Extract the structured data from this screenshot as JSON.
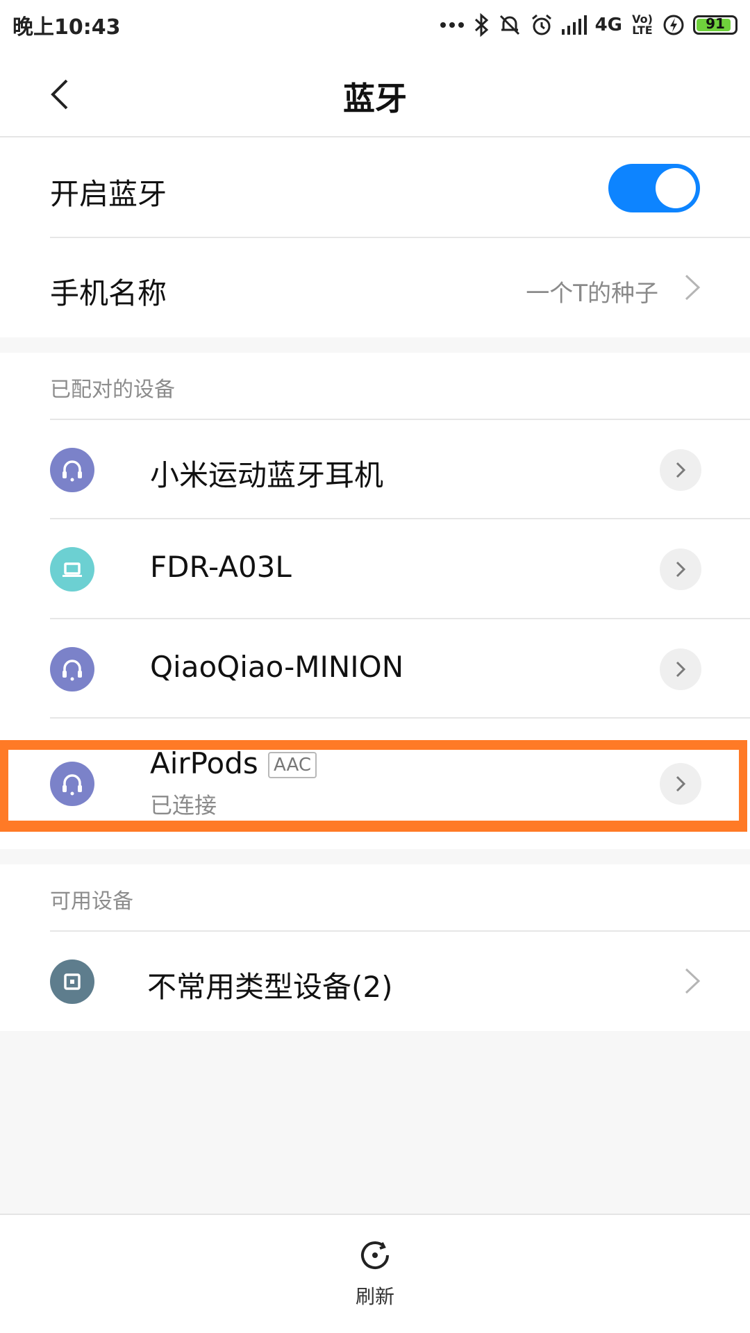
{
  "status_bar": {
    "time": "晚上10:43",
    "network": "4G",
    "volte": "Vo) LTE",
    "battery": "91",
    "battery_level": 0.91
  },
  "header": {
    "title": "蓝牙",
    "back_icon": "chevron-left-icon"
  },
  "settings": {
    "bluetooth_toggle_label": "开启蓝牙",
    "bluetooth_on": true,
    "phone_name_label": "手机名称",
    "phone_name_value": "一个T的种子"
  },
  "paired": {
    "header": "已配对的设备",
    "devices": [
      {
        "name": "小米运动蓝牙耳机",
        "icon": "headset-icon",
        "color": "#7b82c9"
      },
      {
        "name": "FDR-A03L",
        "icon": "laptop-icon",
        "color": "#6cd0d2"
      },
      {
        "name": "QiaoQiao-MINION",
        "icon": "headset-icon",
        "color": "#7b82c9"
      },
      {
        "name": "AirPods",
        "badge": "AAC",
        "status": "已连接",
        "icon": "headset-icon",
        "color": "#7b82c9"
      }
    ]
  },
  "available": {
    "header": "可用设备",
    "items": [
      {
        "name": "不常用类型设备(2)",
        "icon": "unknown-device-icon",
        "color": "#5e7d8d"
      }
    ]
  },
  "bottom": {
    "refresh_label": "刷新",
    "refresh_icon": "refresh-icon"
  },
  "colors": {
    "accent": "#0d84ff",
    "highlight": "#ff7a26"
  }
}
